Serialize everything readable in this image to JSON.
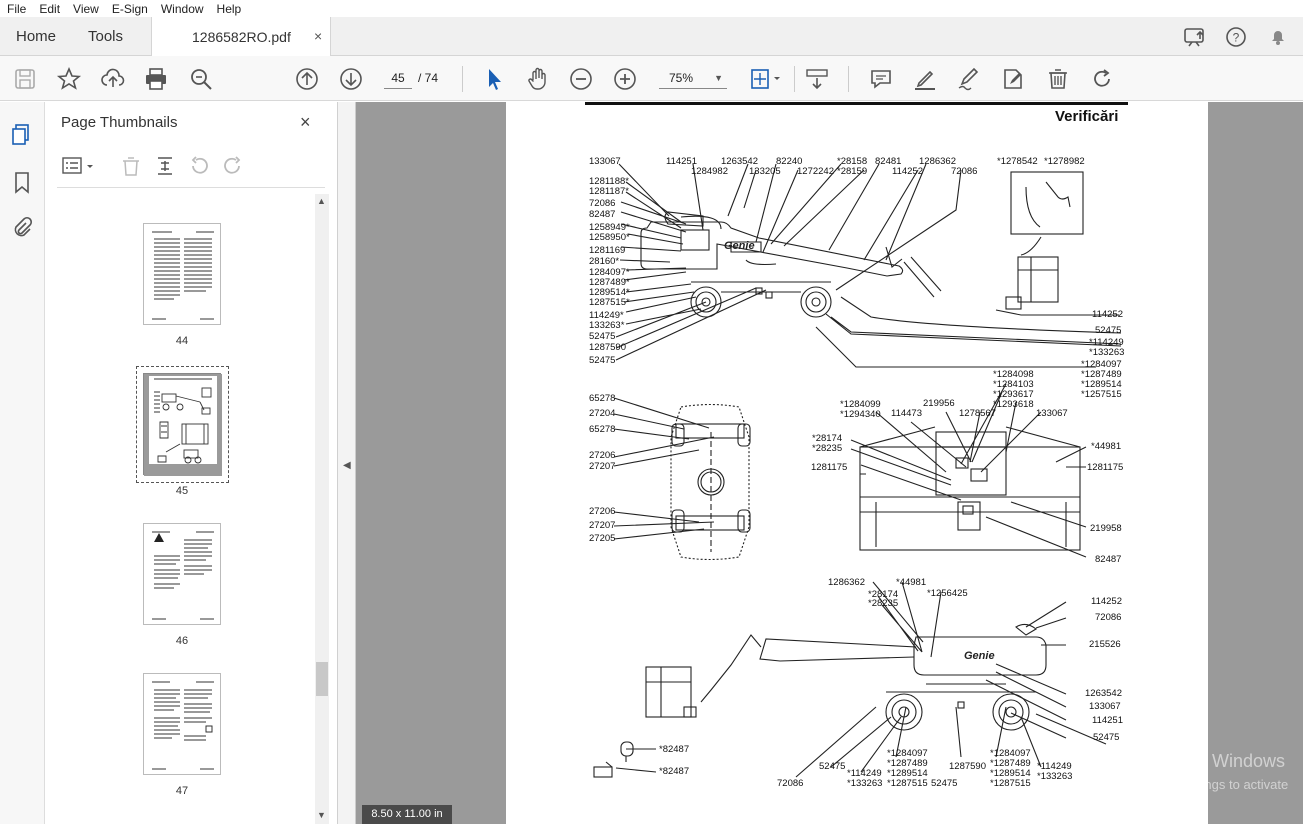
{
  "menu": [
    "File",
    "Edit",
    "View",
    "E-Sign",
    "Window",
    "Help"
  ],
  "tabs": {
    "home": "Home",
    "tools": "Tools",
    "document": "1286582RO.pdf",
    "close": "×"
  },
  "toolbar": {
    "page_current": "45",
    "page_total": "/   74",
    "zoom": "75%"
  },
  "panel": {
    "title": "Page Thumbnails",
    "close": "×",
    "thumbs": [
      {
        "label": "44"
      },
      {
        "label": "45"
      },
      {
        "label": "46"
      },
      {
        "label": "47"
      }
    ]
  },
  "viewer": {
    "page_size": "8.50 x 11.00 in",
    "watermark_title": "Activate Windows",
    "watermark_sub": "Go to Settings to activate"
  },
  "document": {
    "heading": "Verificări",
    "labels": {
      "a1": "133067",
      "a2": "114251",
      "a3": "1263542",
      "a4": "82240",
      "a5": "*28158",
      "a6": "82481",
      "a7": "1286362",
      "a8": "1284982",
      "a9": "133205",
      "a10": "1272242",
      "a11": "*28159",
      "a12": "114252",
      "a13": "72086",
      "b1": "1281188*",
      "b2": "1281187*",
      "b3": "72086",
      "b4": "82487",
      "b5": "1258949*",
      "b6": "1258950*",
      "b7": "1281169",
      "b8": "28160*",
      "b9": "1284097*",
      "b10": "1287489*",
      "b11": "1289514*",
      "b12": "1287515*",
      "b13": "114249*",
      "b14": "133263*",
      "b15": "52475",
      "b16": "1287590",
      "b17": "52475",
      "c1": "*1278542",
      "c2": "*1278982",
      "d1": "114252",
      "d2": "52475",
      "d3": "*114249",
      "d4": "*133263",
      "d5": "*1284097",
      "d6": "*1287489",
      "d7": "*1289514",
      "d8": "*1257515",
      "e1": "65278",
      "e2": "27204",
      "e3": "65278",
      "e4": "27206",
      "e5": "27207",
      "e6": "27206",
      "e7": "27207",
      "e8": "27205",
      "f1": "*1284098",
      "f2": "*1284103",
      "f3": "*1293617",
      "f4": "*1293618",
      "f5": "*1284099",
      "f6": "*1294340",
      "f7": "114473",
      "f8": "219956",
      "f9": "1278567",
      "f10": "133067",
      "f11": "*28174",
      "f12": "*28235",
      "f13": "*44981",
      "f14": "1281175",
      "f15": "1281175",
      "f16": "219958",
      "f17": "82487",
      "g1": "1286362",
      "g2": "*44981",
      "g3": "*28174",
      "g4": "*28235",
      "g5": "*1256425",
      "g6": "114252",
      "g7": "72086",
      "g8": "215526",
      "g9": "1263542",
      "g10": "133067",
      "g11": "114251",
      "g12": "52475",
      "h1": "*82487",
      "h2": "*82487",
      "h3": "72086",
      "h4": "52475",
      "h5": "*114249",
      "h6": "*133263",
      "h7": "*1284097",
      "h8": "*1287489",
      "h9": "*1289514",
      "h10": "*1287515",
      "h11": "1287590",
      "h12": "52475",
      "h13": "*1284097",
      "h14": "*1287489",
      "h15": "*1289514",
      "h16": "*1287515",
      "h17": "*114249",
      "h18": "*133263",
      "genie1": "Genie",
      "genie2": "Genie"
    }
  }
}
